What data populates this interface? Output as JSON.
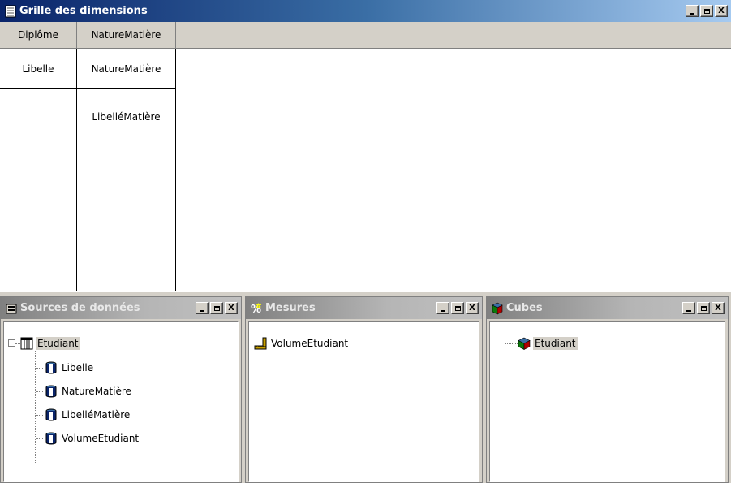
{
  "grid_window": {
    "title": "Grille des dimensions",
    "headers": [
      "Diplôme",
      "NatureMatière"
    ],
    "columns": [
      {
        "cells": [
          "Libelle"
        ]
      },
      {
        "cells": [
          "NatureMatière",
          "LibelléMatière"
        ]
      }
    ]
  },
  "sources_window": {
    "title": "Sources de données",
    "root": "Etudiant",
    "items": [
      "Libelle",
      "NatureMatière",
      "LibelléMatière",
      "VolumeEtudiant"
    ]
  },
  "mesures_window": {
    "title": "Mesures",
    "items": [
      "VolumeEtudiant"
    ]
  },
  "cubes_window": {
    "title": "Cubes",
    "items": [
      "Etudiant"
    ]
  },
  "window_buttons": {
    "close": "X"
  },
  "colors": {
    "active_title_start": "#0a246a",
    "active_title_end": "#a6caf0",
    "inactive_title": "#808080",
    "face": "#d4d0c8"
  },
  "icons": {
    "grid": "table-window-icon",
    "sources": "datasource-icon",
    "table": "table-icon",
    "column": "column-cylinder-icon",
    "measure": "measure-ruler-icon",
    "mesures": "measures-hash-icon",
    "cube": "cube-icon"
  }
}
